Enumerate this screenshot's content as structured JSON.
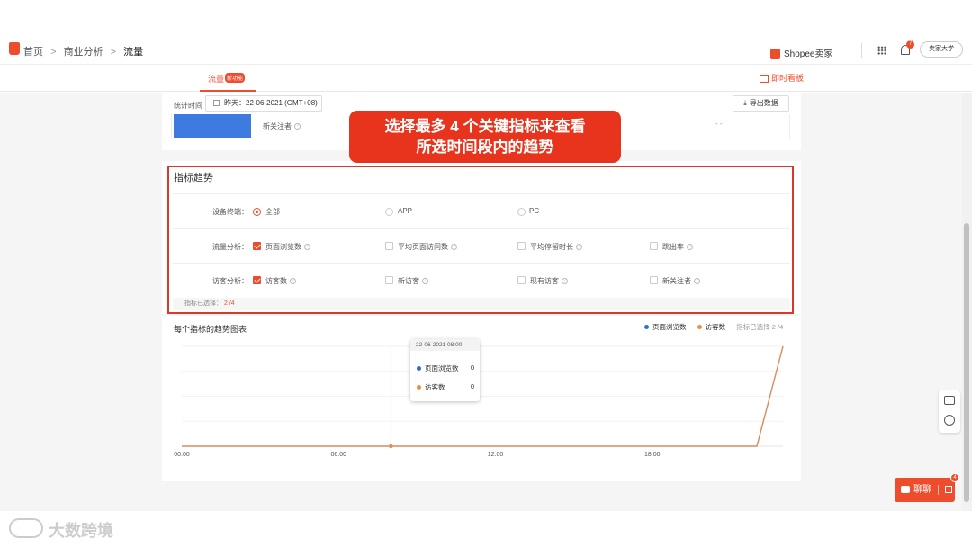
{
  "breadcrumb": {
    "home": "首页",
    "sep1": ">",
    "section": "商业分析",
    "sep2": ">",
    "current": "流量"
  },
  "header": {
    "brand": "Shopee卖家",
    "notif_count": "7",
    "university_button": "卖家大学"
  },
  "nav": {
    "active_tab": "流量",
    "active_badge": "新功能",
    "realtime": "即时看板"
  },
  "filters": {
    "stat_time_label": "统计时间",
    "date_value": "昨天：22-06-2021 (GMT+08)",
    "export_label": "导出数据"
  },
  "summary": {
    "new_followers_label": "新关注者",
    "value": "- -"
  },
  "callout": {
    "line1": "选择最多 4 个关键指标来查看",
    "line2": "所选时间段内的趋势"
  },
  "trend": {
    "title": "指标趋势",
    "device_label": "设备终端：",
    "device_options": [
      "全部",
      "APP",
      "PC"
    ],
    "device_selected": "全部",
    "traffic_label": "流量分析：",
    "traffic_options": [
      "页面浏览数",
      "平均页面访问数",
      "平均停留时长",
      "跳出率"
    ],
    "visitor_label": "访客分析：",
    "visitor_options": [
      "访客数",
      "新访客",
      "现有访客",
      "新关注者"
    ],
    "selected_label": "指标已选择：",
    "selected_count": "2 /4"
  },
  "chart_section": {
    "title": "每个指标的趋势图表",
    "legend_selected": "指标已选择 2 /4"
  },
  "tooltip": {
    "time": "22-06-2021 08:00",
    "rows": [
      {
        "label": "页面浏览数",
        "value": "0"
      },
      {
        "label": "访客数",
        "value": "0"
      }
    ]
  },
  "chart_data": {
    "type": "line",
    "x": [
      "00:00",
      "01:00",
      "02:00",
      "03:00",
      "04:00",
      "05:00",
      "06:00",
      "07:00",
      "08:00",
      "09:00",
      "10:00",
      "11:00",
      "12:00",
      "13:00",
      "14:00",
      "15:00",
      "16:00",
      "17:00",
      "18:00",
      "19:00",
      "20:00",
      "21:00",
      "22:00",
      "23:00"
    ],
    "xticks": [
      "00:00",
      "06:00",
      "12:00",
      "18:00"
    ],
    "series": [
      {
        "name": "页面浏览数",
        "color": "#2f6bd1",
        "values": [
          0,
          0,
          0,
          0,
          0,
          0,
          0,
          0,
          0,
          0,
          0,
          0,
          0,
          0,
          0,
          0,
          0,
          0,
          0,
          0,
          0,
          0,
          0,
          1
        ]
      },
      {
        "name": "访客数",
        "color": "#f08b45",
        "values": [
          0,
          0,
          0,
          0,
          0,
          0,
          0,
          0,
          0,
          0,
          0,
          0,
          0,
          0,
          0,
          0,
          0,
          0,
          0,
          0,
          0,
          0,
          0,
          1
        ]
      }
    ],
    "highlight_x": "08:00",
    "grid": true,
    "legend": "top-right"
  },
  "chat": {
    "label": "聊聊",
    "badge": "4"
  },
  "watermark": {
    "text": "大数跨境"
  },
  "colors": {
    "accent": "#ee4d2d",
    "callout": "#e8341c",
    "blue_bar": "#3d7be0"
  }
}
